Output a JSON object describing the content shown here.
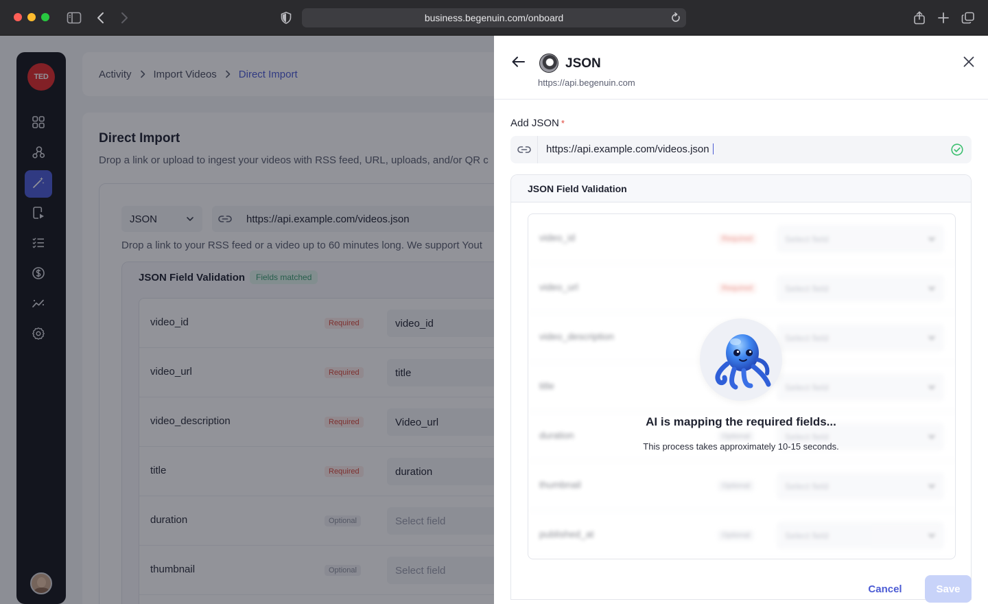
{
  "browser": {
    "url": "business.begenuin.com/onboard"
  },
  "sidebar": {
    "brand": "TED",
    "items": [
      {
        "icon": "grid-icon"
      },
      {
        "icon": "share-nodes-icon"
      },
      {
        "icon": "magic-wand-icon",
        "active": true
      },
      {
        "icon": "video-document-icon"
      },
      {
        "icon": "list-check-icon"
      },
      {
        "icon": "dollar-icon"
      },
      {
        "icon": "analytics-icon"
      },
      {
        "icon": "gear-icon"
      }
    ]
  },
  "breadcrumb": {
    "items": [
      "Activity",
      "Import Videos",
      "Direct Import"
    ]
  },
  "main": {
    "title": "Direct Import",
    "subtitle": "Drop a link or upload to ingest your videos with RSS feed, URL, uploads, and/or QR c",
    "source_type": "JSON",
    "url_value": "https://api.example.com/videos.json",
    "help_text": "Drop a link to your RSS feed or a video up to 60 minutes long. We support Yout",
    "validation_title": "JSON Field Validation",
    "matched_badge": "Fields matched",
    "fields": [
      {
        "name": "video_id",
        "badge": "Required",
        "value": "video_id"
      },
      {
        "name": "video_url",
        "badge": "Required",
        "value": "title"
      },
      {
        "name": "video_description",
        "badge": "Required",
        "value": "Video_url"
      },
      {
        "name": "title",
        "badge": "Required",
        "value": "duration"
      },
      {
        "name": "duration",
        "badge": "Optional",
        "value": "Select field"
      },
      {
        "name": "thumbnail",
        "badge": "Optional",
        "value": "Select field"
      }
    ]
  },
  "panel": {
    "title": "JSON",
    "subtitle": "https://api.begenuin.com",
    "input_label": "Add JSON",
    "input_required_mark": "*",
    "input_value": "https://api.example.com/videos.json",
    "validation_title": "JSON Field Validation",
    "rows": [
      {
        "name": "video_id",
        "badge": "Required",
        "placeholder": "Select field"
      },
      {
        "name": "video_url",
        "badge": "Required",
        "placeholder": "Select field"
      },
      {
        "name": "video_description",
        "badge": "",
        "placeholder": "Select field"
      },
      {
        "name": "title",
        "badge": "",
        "placeholder": "Select field"
      },
      {
        "name": "duration",
        "badge": "Optional",
        "placeholder": "Select field"
      },
      {
        "name": "thumbnail",
        "badge": "Optional",
        "placeholder": "Select field"
      },
      {
        "name": "published_at",
        "badge": "Optional",
        "placeholder": "Select field"
      }
    ],
    "loading_title": "AI is mapping the required fields...",
    "loading_subtitle": "This process takes approximately 10-15 seconds.",
    "cancel_label": "Cancel",
    "save_label": "Save"
  },
  "colors": {
    "accent": "#4b5bd4",
    "required": "#d8473a",
    "success": "#3bbf6e",
    "save_disabled": "#c8d3f9"
  }
}
